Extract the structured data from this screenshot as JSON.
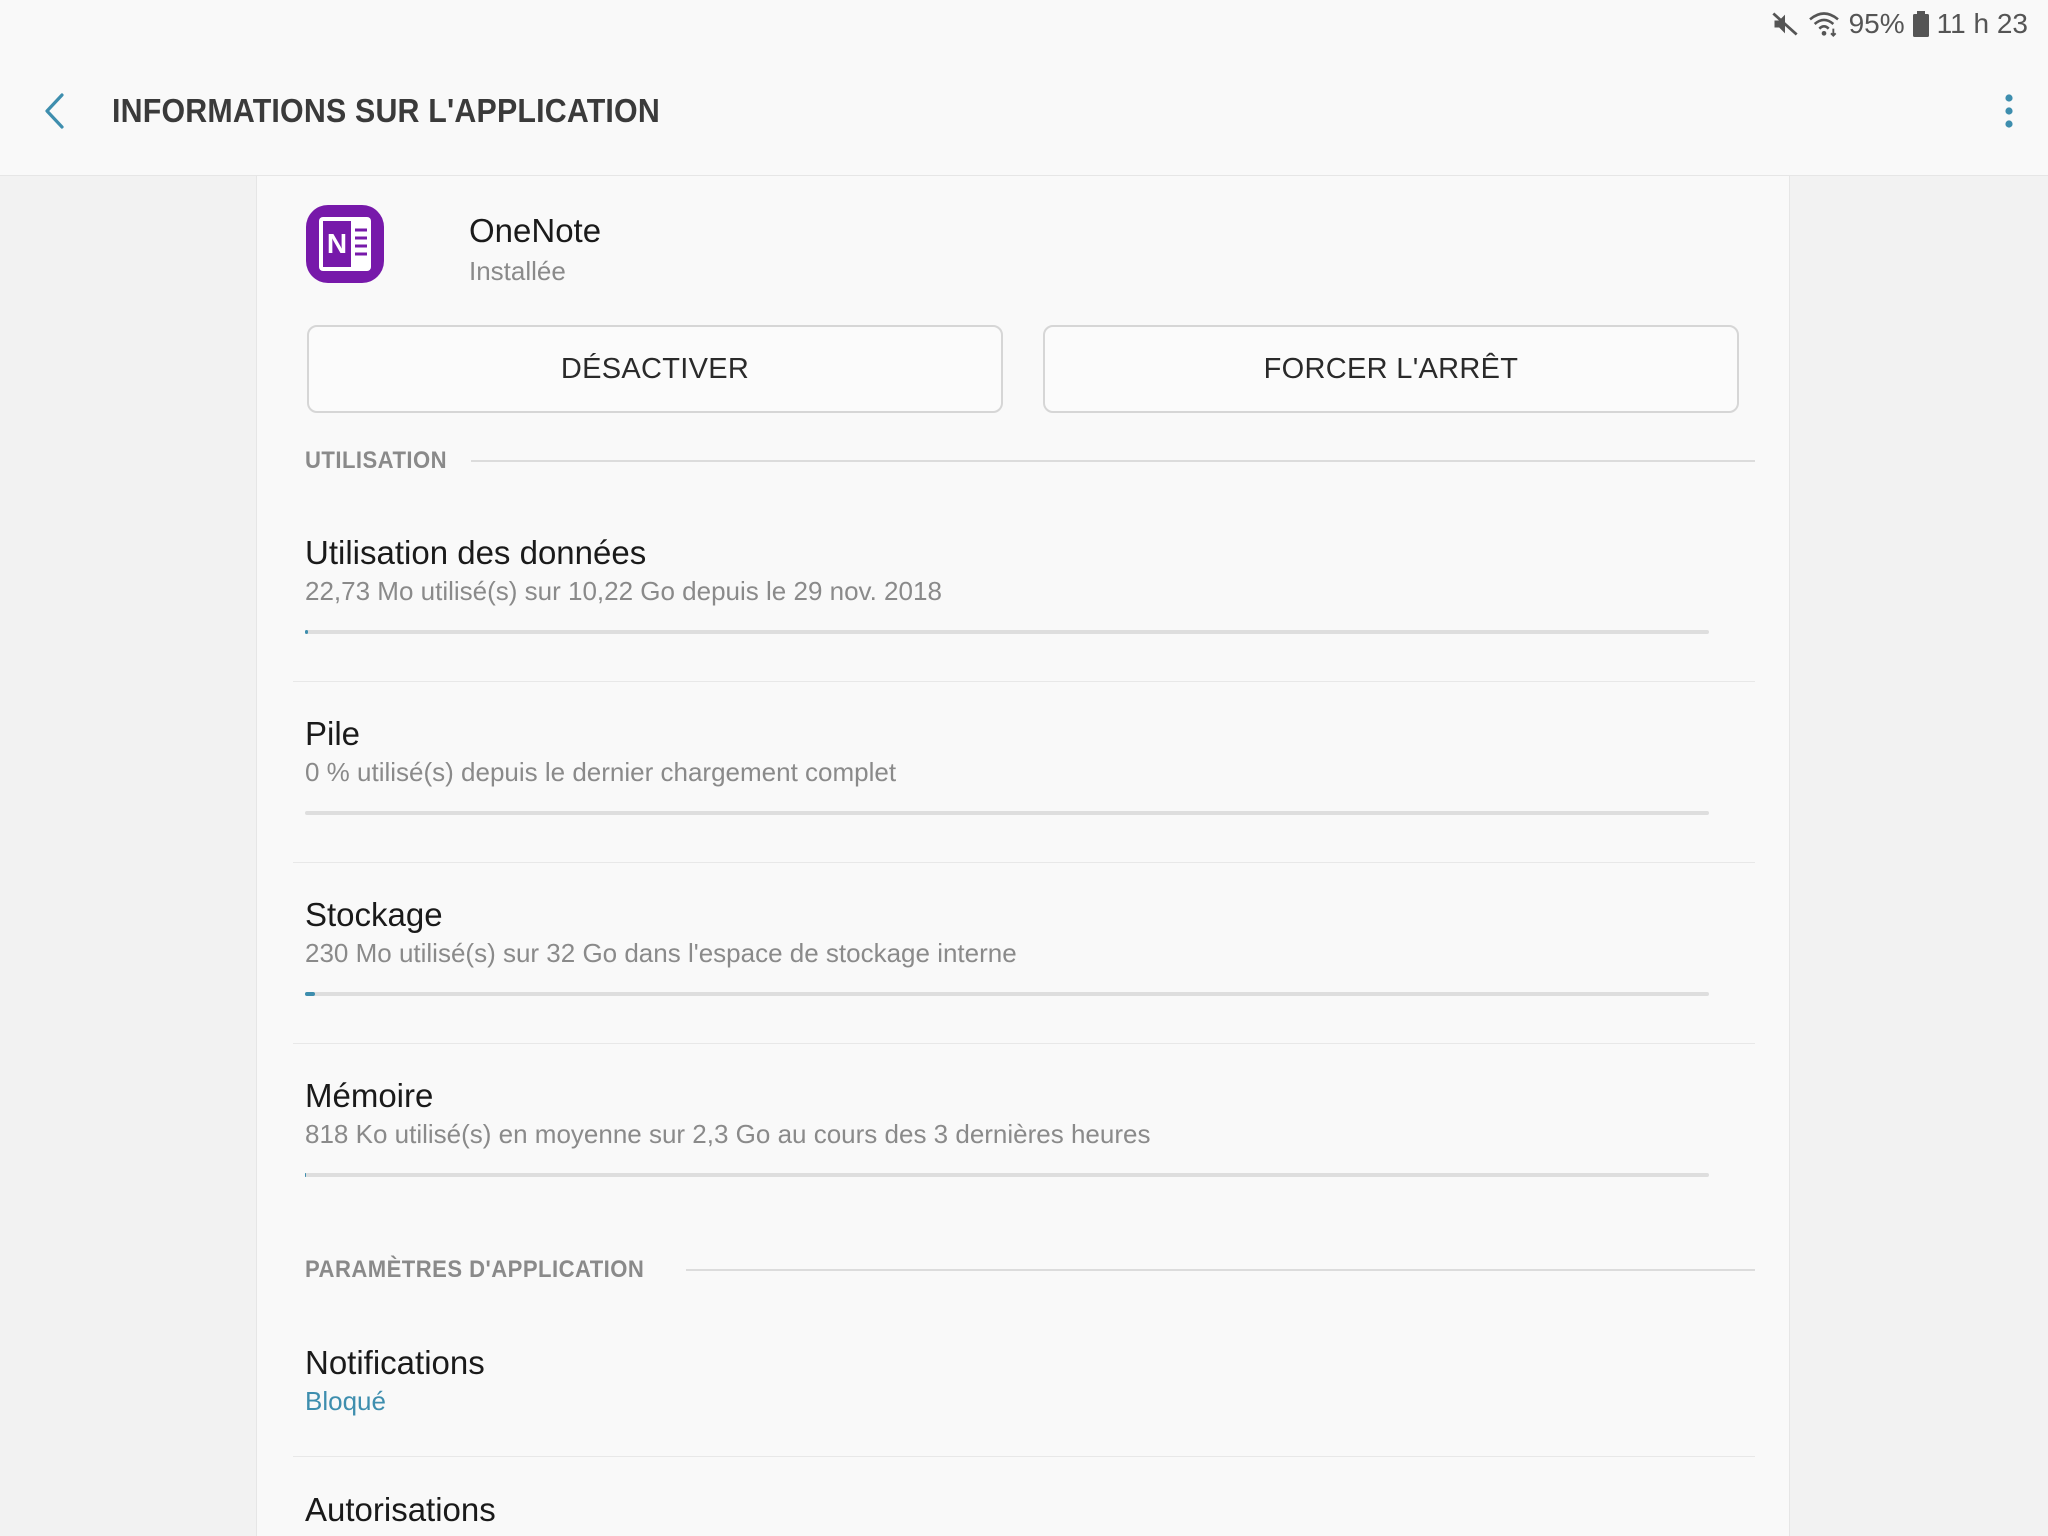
{
  "status_bar": {
    "battery": "95%",
    "time": "11 h 23",
    "icons": [
      "mute-icon",
      "wifi-icon",
      "battery-icon"
    ]
  },
  "app_bar": {
    "title": "INFORMATIONS SUR L'APPLICATION",
    "back_icon": "chevron-left-icon",
    "more_icon": "more-vert-icon"
  },
  "app": {
    "name": "OneNote",
    "status": "Installée",
    "icon": "onenote-icon",
    "brand_color": "#7719aa"
  },
  "buttons": {
    "disable_label": "DÉSACTIVER",
    "force_stop_label": "FORCER L'ARRÊT"
  },
  "sections": {
    "usage": "UTILISATION",
    "app_settings": "PARAMÈTRES D'APPLICATION"
  },
  "usage_items": [
    {
      "title": "Utilisation des données",
      "subtitle": "22,73 Mo utilisé(s) sur 10,22 Go depuis le 29 nov. 2018",
      "progress": 0.002
    },
    {
      "title": "Pile",
      "subtitle": "0 % utilisé(s) depuis le dernier chargement complet",
      "progress": 0.0
    },
    {
      "title": "Stockage",
      "subtitle": "230 Mo utilisé(s) sur 32 Go dans l'espace de stockage interne",
      "progress": 0.007
    },
    {
      "title": "Mémoire",
      "subtitle": "818 Ko utilisé(s) en moyenne sur 2,3 Go au cours des 3 dernières heures",
      "progress": 0.0003
    }
  ],
  "settings_items": [
    {
      "title": "Notifications",
      "subtitle": "Bloqué"
    },
    {
      "title": "Autorisations"
    }
  ],
  "colors": {
    "accent": "#3e8eae",
    "secondary_text": "#8a8a8a",
    "background": "#f2f2f2",
    "card": "#f9f9f9"
  }
}
